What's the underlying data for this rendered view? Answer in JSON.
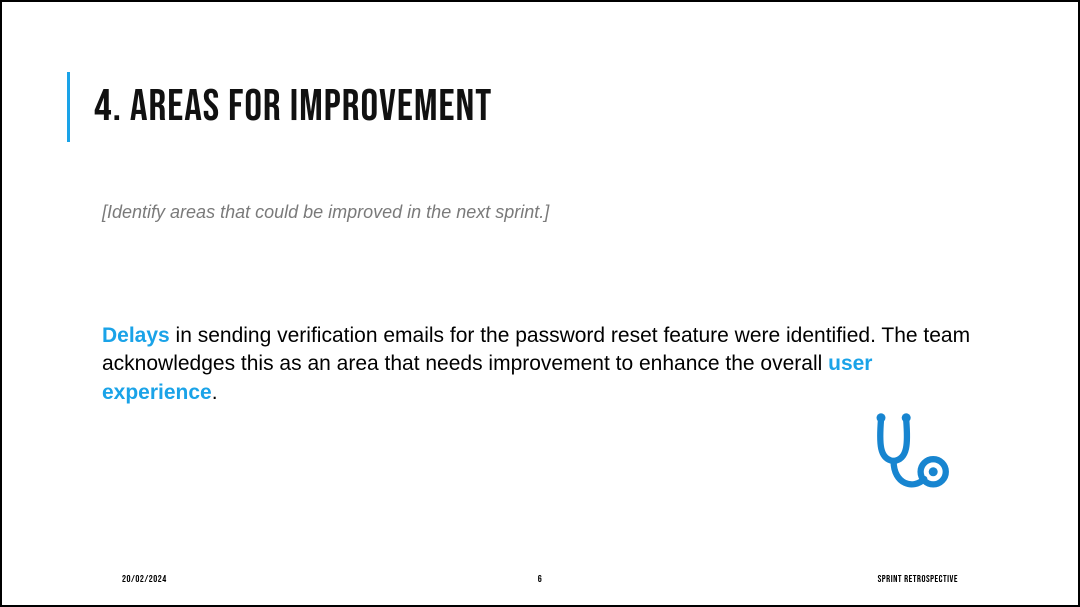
{
  "title": "4. AREAS FOR IMPROVEMENT",
  "subtitle": "[Identify areas that could be improved in the next sprint.]",
  "body": {
    "hl1": "Delays",
    "t1": " in sending verification emails for the password reset feature were identified. The team acknowledges this as an area that needs improvement to enhance the overall ",
    "hl2": "user experience",
    "t2": "."
  },
  "footer": {
    "date": "20/02/2024",
    "page": "6",
    "label": "SPRINT RETROSPECTIVE"
  },
  "accent": "#1aa3e8",
  "icon": "stethoscope-icon"
}
